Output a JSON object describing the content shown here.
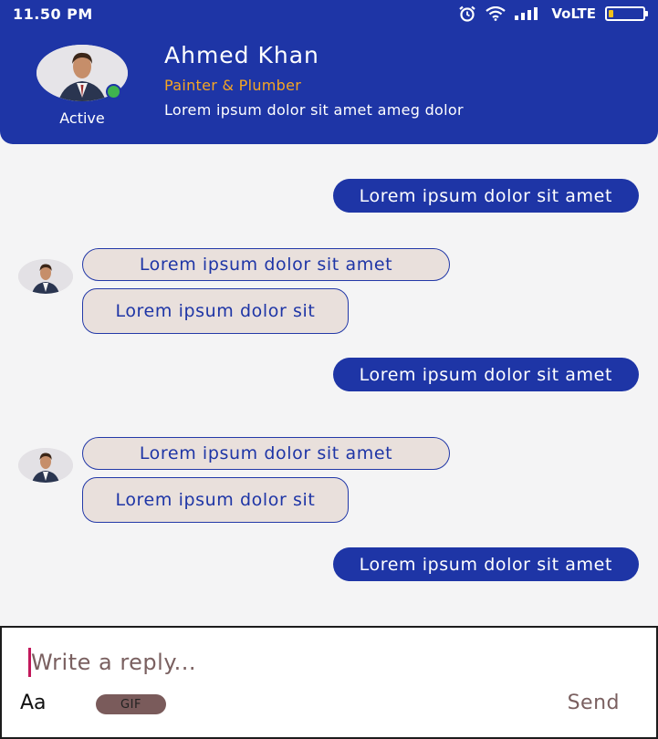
{
  "status_bar": {
    "time": "11.50 PM",
    "network": "VoLTE",
    "battery_level": 0.15,
    "battery_color": "#f2c11a"
  },
  "header": {
    "contact_name": "Ahmed Khan",
    "role": "Painter & Plumber",
    "description": "Lorem ipsum dolor sit amet ameg dolor",
    "status": "Active",
    "background_color": "#1e35a6",
    "role_color": "#f5a623",
    "online_color": "#3fb34f"
  },
  "messages": [
    {
      "direction": "outgoing",
      "text": "Lorem ipsum dolor sit amet"
    },
    {
      "direction": "incoming",
      "text": "Lorem ipsum dolor sit amet"
    },
    {
      "direction": "incoming",
      "text": "Lorem ipsum dolor sit"
    },
    {
      "direction": "outgoing",
      "text": "Lorem ipsum dolor sit amet"
    },
    {
      "direction": "incoming",
      "text": "Lorem ipsum dolor sit amet"
    },
    {
      "direction": "incoming",
      "text": "Lorem ipsum dolor sit"
    },
    {
      "direction": "outgoing",
      "text": "Lorem ipsum dolor sit amet"
    }
  ],
  "reply": {
    "placeholder": "Write a reply...",
    "font_button": "Aa",
    "gif_button": "GIF",
    "send_button": "Send"
  },
  "icons": [
    "alarm-icon",
    "wifi-icon",
    "signal-icon",
    "battery-icon",
    "avatar-icon"
  ]
}
